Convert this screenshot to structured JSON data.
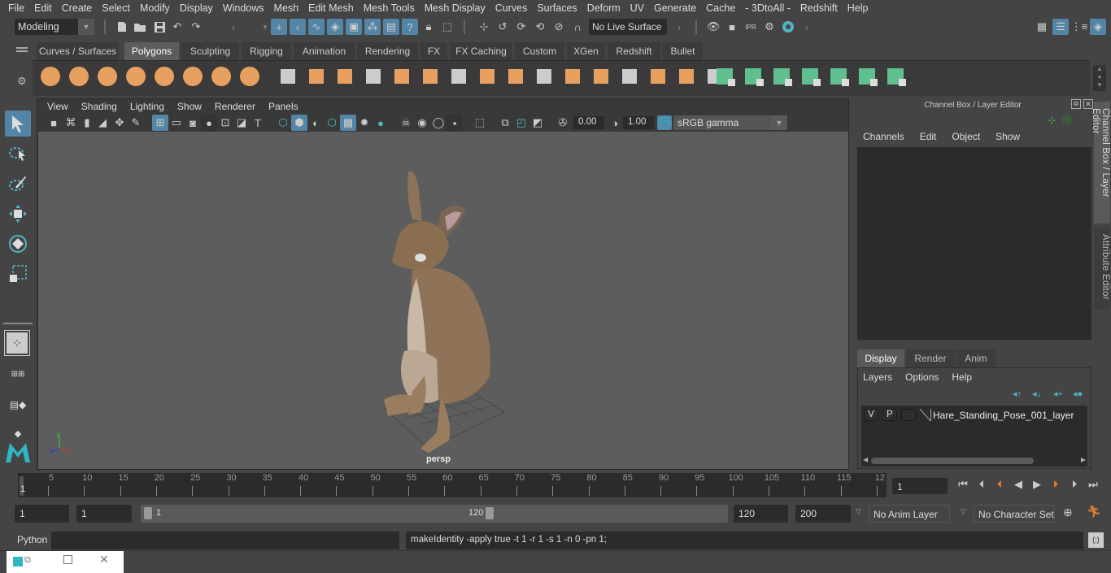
{
  "menubar": {
    "items": [
      "File",
      "Edit",
      "Create",
      "Select",
      "Modify",
      "Display",
      "Windows",
      "Mesh",
      "Edit Mesh",
      "Mesh Tools",
      "Mesh Display",
      "Curves",
      "Surfaces",
      "Deform",
      "UV",
      "Generate",
      "Cache",
      "- 3DtoAll -",
      "Redshift",
      "Help"
    ]
  },
  "statusline": {
    "mode": "Modeling",
    "live_surface": "No Live Surface"
  },
  "shelf": {
    "tabs": [
      "Curves / Surfaces",
      "Polygons",
      "Sculpting",
      "Rigging",
      "Animation",
      "Rendering",
      "FX",
      "FX Caching",
      "Custom",
      "XGen",
      "Redshift",
      "Bullet"
    ],
    "active_tab": "Polygons"
  },
  "viewport": {
    "menu": [
      "View",
      "Shading",
      "Lighting",
      "Show",
      "Renderer",
      "Panels"
    ],
    "exposure": "0.00",
    "gamma": "1.00",
    "color_mgmt_toggle": "ON",
    "color_space": "sRGB gamma",
    "camera_label": "persp",
    "axis": {
      "x": "x",
      "y": "y",
      "z": "z"
    }
  },
  "channelbox": {
    "title": "Channel Box / Layer Editor",
    "menu": [
      "Channels",
      "Edit",
      "Object",
      "Show"
    ],
    "layer_tabs": [
      "Display",
      "Render",
      "Anim"
    ],
    "active_layer_tab": "Display",
    "layer_menu": [
      "Layers",
      "Options",
      "Help"
    ],
    "layers": [
      {
        "v": "V",
        "p": "P",
        "name": "Hare_Standing_Pose_001_layer"
      }
    ],
    "side_tabs": [
      "Channel Box / Layer Editor",
      "Attribute Editor"
    ]
  },
  "timeline": {
    "ticks": [
      "5",
      "10",
      "15",
      "20",
      "25",
      "30",
      "35",
      "40",
      "45",
      "50",
      "55",
      "60",
      "65",
      "70",
      "75",
      "80",
      "85",
      "90",
      "95",
      "100",
      "105",
      "110",
      "115",
      "12"
    ],
    "current_frame_marker": "1",
    "current_frame": "1"
  },
  "range": {
    "start_frame": "1",
    "playback_start": "1",
    "slider_start": "1",
    "slider_end": "120",
    "playback_end": "120",
    "end_frame": "200",
    "anim_layer": "No Anim Layer",
    "character_set": "No Character Set"
  },
  "commandline": {
    "language": "Python",
    "input": "",
    "result": "makeIdentity -apply true -t 1 -r 1 -s 1 -n 0 -pn 1;"
  },
  "colors": {
    "accent": "#5285a6",
    "poly_icon": "#e8a060",
    "green_icon": "#5fbf8f",
    "timeline_key": "#e07a30"
  }
}
